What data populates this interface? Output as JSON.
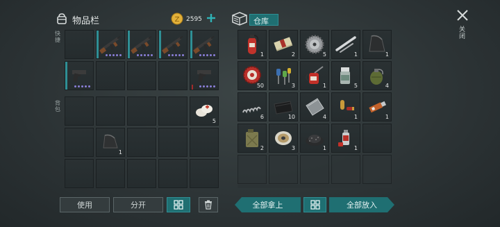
{
  "inventory": {
    "title": "物品栏",
    "coins": "2595",
    "quick_label": "快捷",
    "backpack_label": "背包"
  },
  "warehouse": {
    "title": "仓库"
  },
  "close": {
    "label": "关闭"
  },
  "quantities": {
    "bandage": "5",
    "sheet": "1",
    "w_extinguisher": "1",
    "w_cash": "2",
    "w_blade": "5",
    "w_pipe": "1",
    "w_plate": "1",
    "w_caps": "50",
    "w_wires": "3",
    "w_oilcan": "1",
    "w_pills": "5",
    "w_grenade": "4",
    "w_spring": "6",
    "w_wallet": "10",
    "w_metal": "4",
    "w_ammo": "1",
    "w_usb": "1",
    "w_jerrycan": "2",
    "w_wire": "3",
    "w_gunpowder": "1",
    "w_spray": "1"
  },
  "buttons": {
    "use": "使用",
    "split": "分开",
    "take_all": "全部拿上",
    "put_all": "全部放入"
  },
  "colors": {
    "accent": "#2f8f95",
    "button_teal": "#1f6f72",
    "quality_dots": "#8a7fd8",
    "coin": "#e3b13a"
  }
}
